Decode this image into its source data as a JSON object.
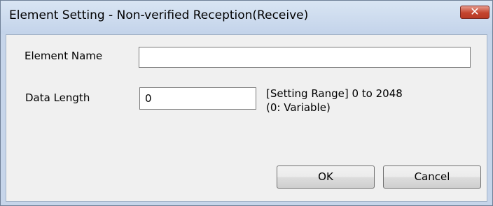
{
  "dialog": {
    "title": "Element Setting - Non-verified Reception(Receive)",
    "close_icon": "close-icon",
    "close_glyph": "✕",
    "accent_close": "#c4452f"
  },
  "form": {
    "element_name_label": "Element Name",
    "element_name_value": "",
    "data_length_label": "Data Length",
    "data_length_value": "0",
    "range_line1": "[Setting Range] 0 to 2048",
    "range_line2": "(0: Variable)"
  },
  "buttons": {
    "ok_label": "OK",
    "cancel_label": "Cancel"
  }
}
